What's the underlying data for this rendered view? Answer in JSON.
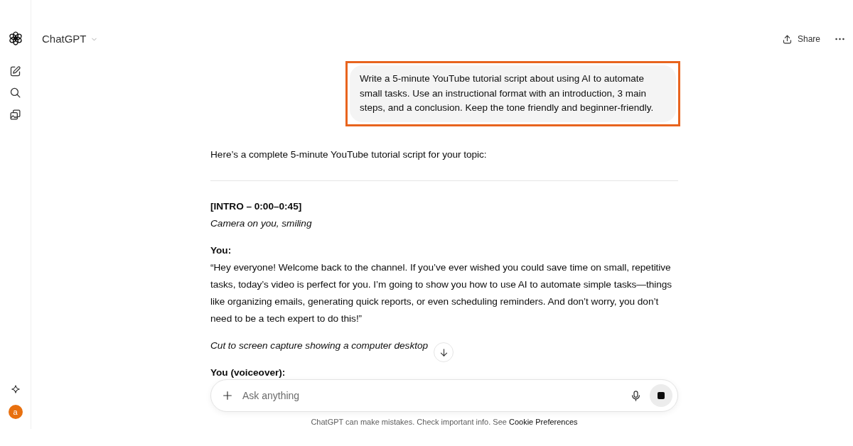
{
  "sidebar": {
    "avatar": "a"
  },
  "header": {
    "title": "ChatGPT",
    "actions": [
      {
        "kind": "share",
        "label": "Share"
      },
      {
        "kind": "more"
      }
    ]
  },
  "user_message": {
    "text": "Write a 5-minute YouTube tutorial script about using AI to automate small tasks. Use an instructional format with an introduction, 3 main steps, and a conclusion. Keep the tone friendly and beginner-friendly.",
    "highlighted": true
  },
  "response": {
    "sections": [
      {
        "kind": "text",
        "lines": [
          {
            "kind": "plain",
            "text": "Here’s a complete 5-minute YouTube tutorial script for your topic:"
          }
        ]
      },
      {
        "kind": "divider"
      },
      {
        "kind": "text",
        "lines": [
          {
            "kind": "heading",
            "text": "[INTRO – 0:00–0:45]"
          },
          {
            "kind": "direction",
            "text": "Camera on you, smiling"
          }
        ]
      },
      {
        "kind": "text",
        "lines": [
          {
            "kind": "speaker",
            "text": "You:"
          },
          {
            "kind": "plain",
            "text": "“Hey everyone! Welcome back to the channel. If you’ve ever wished you could save time on small, repetitive tasks, today’s video is perfect for you. I’m going to show you how to use AI to automate simple tasks—things like organizing emails, generating quick reports, or even scheduling reminders. And don’t worry, you don’t need to be a tech expert to do this!”"
          }
        ]
      },
      {
        "kind": "text",
        "lines": [
          {
            "kind": "direction",
            "text": "Cut to screen capture showing a computer desktop"
          }
        ]
      },
      {
        "kind": "text",
        "lines": [
          {
            "kind": "speaker",
            "text": "You (voiceover):"
          }
        ]
      }
    ]
  },
  "composer": {
    "placeholder": "Ask anything",
    "generating": true
  },
  "footer": {
    "text": "ChatGPT can make mistakes. Check important info. See",
    "link": "Cookie Preferences"
  }
}
